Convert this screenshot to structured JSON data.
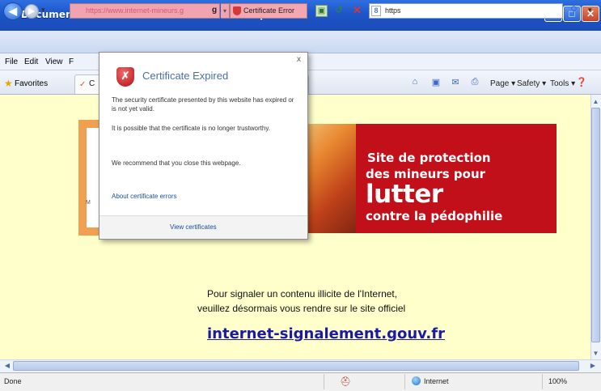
{
  "window": {
    "title": "Document sans nom - Windows Internet Explorer",
    "minimize_glyph": "–",
    "maximize_glyph": "□",
    "close_glyph": "✕"
  },
  "address_bar": {
    "url": "https://www.internet-mineurs.g",
    "url_suffix": "g",
    "certificate_error_label": "Certificate Error",
    "search_value": "https"
  },
  "menu": {
    "items": [
      "File",
      "Edit",
      "View",
      "F"
    ]
  },
  "favorites_bar": {
    "favorites_label": "Favorites",
    "tab_initial": "C",
    "tools": [
      "Page ▾",
      "Safety ▾",
      "Tools ▾"
    ]
  },
  "page": {
    "banner": {
      "line1": "Site de protection",
      "line2": "des mineurs pour",
      "line3": "lutter",
      "line4": "contre la pédophilie",
      "left_panel_text": "M"
    },
    "notice_line1": "Pour signaler un contenu illicite de l'Internet,",
    "notice_line2": "veuillez désormais vous rendre sur le site officiel",
    "link": "internet-signalement.gouv.fr"
  },
  "popup": {
    "title": "Certificate Expired",
    "p1": "The security certificate presented by this website has expired or is not yet valid.",
    "p2": "It is possible that the certificate is no longer trustworthy.",
    "p3": "We recommend that you close this webpage.",
    "link": "About certificate errors",
    "view_button": "View certificates",
    "close_glyph": "x"
  },
  "status_bar": {
    "status": "Done",
    "zone": "Internet",
    "zoom": "100%"
  },
  "colors": {
    "titlebar": "#1e55c8",
    "certificate_error_bg": "#f4a7b0",
    "page_bg": "#ffffcc",
    "banner_red": "#c1101a",
    "link": "#1a1aa6"
  }
}
